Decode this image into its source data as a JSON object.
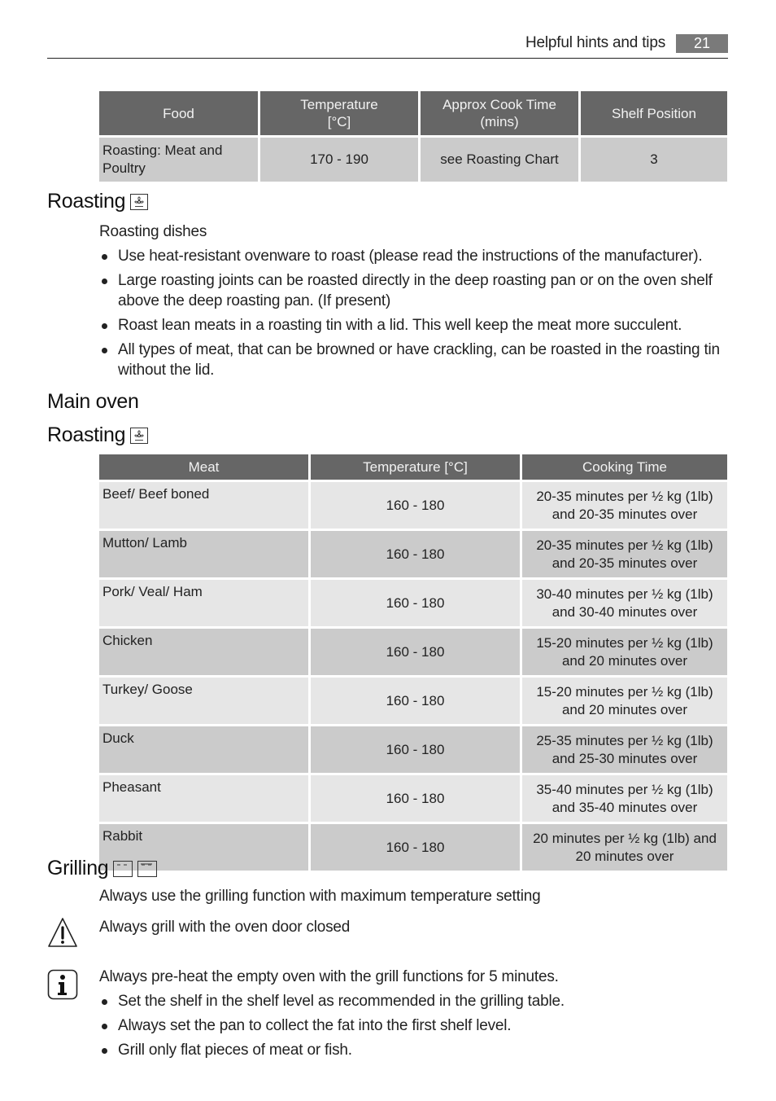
{
  "header": {
    "section_title": "Helpful hints and tips",
    "page_number": "21"
  },
  "food_table": {
    "headers": [
      "Food",
      "Temperature [°C]",
      "Approx Cook Time (mins)",
      "Shelf Position"
    ],
    "header_lines": {
      "temperature_line1": "Temperature",
      "temperature_line2": "[°C]",
      "cook_time_line1": "Approx Cook Time",
      "cook_time_line2": "(mins)"
    },
    "rows": [
      {
        "food": "Roasting: Meat and Poultry",
        "temperature": "170 - 190",
        "cook_time": "see Roasting Chart",
        "shelf": "3"
      }
    ]
  },
  "roasting_section": {
    "title": "Roasting",
    "icon": "fan-heating-icon",
    "subtitle": "Roasting dishes",
    "bullets": [
      "Use heat-resistant ovenware to roast (please read the instructions of the manufacturer).",
      "Large roasting joints can be roasted directly in the deep roasting pan or on the oven shelf above the deep roasting pan. (If present)",
      "Roast lean meats in a roasting tin with a lid. This well keep the meat more succulent.",
      "All types of meat, that can be browned or have crackling, can be roasted in the roasting tin without the lid."
    ]
  },
  "main_oven": {
    "title": "Main oven",
    "roasting_title": "Roasting",
    "icon": "fan-heating-icon"
  },
  "meat_table": {
    "headers": [
      "Meat",
      "Temperature [°C]",
      "Cooking Time"
    ],
    "rows": [
      {
        "meat": "Beef/ Beef boned",
        "temperature": "160 - 180",
        "time_line1": "20-35 minutes per ½ kg (1lb)",
        "time_line2": "and 20-35 minutes over"
      },
      {
        "meat": "Mutton/ Lamb",
        "temperature": "160 - 180",
        "time_line1": "20-35 minutes per ½ kg (1lb)",
        "time_line2": "and 20-35 minutes over"
      },
      {
        "meat": "Pork/ Veal/ Ham",
        "temperature": "160 - 180",
        "time_line1": "30-40 minutes per ½ kg (1lb)",
        "time_line2": "and 30-40 minutes over"
      },
      {
        "meat": "Chicken",
        "temperature": "160 - 180",
        "time_line1": "15-20 minutes per ½ kg (1lb)",
        "time_line2": "and 20 minutes over"
      },
      {
        "meat": "Turkey/ Goose",
        "temperature": "160 - 180",
        "time_line1": "15-20 minutes per ½ kg (1lb)",
        "time_line2": "and 20 minutes over"
      },
      {
        "meat": "Duck",
        "temperature": "160 - 180",
        "time_line1": "25-35 minutes per ½ kg (1lb)",
        "time_line2": "and 25-30 minutes over"
      },
      {
        "meat": "Pheasant",
        "temperature": "160 - 180",
        "time_line1": "35-40 minutes per ½ kg (1lb)",
        "time_line2": "and 35-40 minutes over"
      },
      {
        "meat": "Rabbit",
        "temperature": "160 - 180",
        "time_line1": "20 minutes per ½ kg (1lb) and",
        "time_line2": "20 minutes over"
      }
    ]
  },
  "grilling_section": {
    "title": "Grilling",
    "icons": [
      "grill-icon",
      "full-grill-icon"
    ],
    "subtitle": "Always use the grilling function with maximum temperature setting",
    "warning_text": "Always grill with the oven door closed",
    "info_text": "Always pre-heat the empty oven with the grill functions for 5 minutes.",
    "bullets": [
      "Set the shelf in the shelf level as recommended in the grilling table.",
      "Always set the pan to collect the fat into the first shelf level.",
      "Grill only flat pieces of meat or fish."
    ]
  },
  "colors": {
    "table_header_bg": "#666666",
    "row_dark_bg": "#cbcbcb",
    "row_light_bg": "#e6e6e6",
    "page_number_bg": "#7a7a7a"
  }
}
